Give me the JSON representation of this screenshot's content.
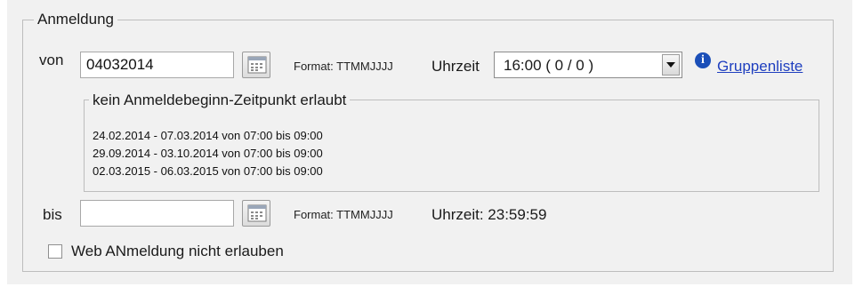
{
  "group": {
    "title": "Anmeldung"
  },
  "from": {
    "label": "von",
    "date_value": "04032014",
    "format_text": "Format: TTMMJJJJ",
    "time_label": "Uhrzeit",
    "time_selected": "16:00 ( 0 / 0 )",
    "info_glyph": "i",
    "group_list_link": "Gruppenliste"
  },
  "restriction": {
    "title": "kein Anmeldebeginn-Zeitpunkt erlaubt",
    "rows": [
      "24.02.2014 - 07.03.2014 von 07:00 bis 09:00",
      "29.09.2014 - 03.10.2014 von 07:00 bis 09:00",
      "02.03.2015 - 06.03.2015 von 07:00 bis 09:00"
    ]
  },
  "to": {
    "label": "bis",
    "date_value": "",
    "format_text": "Format: TTMMJJJJ",
    "time_text": "Uhrzeit: 23:59:59"
  },
  "web": {
    "checkbox_label": "Web ANmeldung nicht erlauben",
    "checked": false
  },
  "icons": {
    "calendar": "calendar-icon",
    "dropdown": "chevron-down-icon",
    "info": "info-icon"
  }
}
